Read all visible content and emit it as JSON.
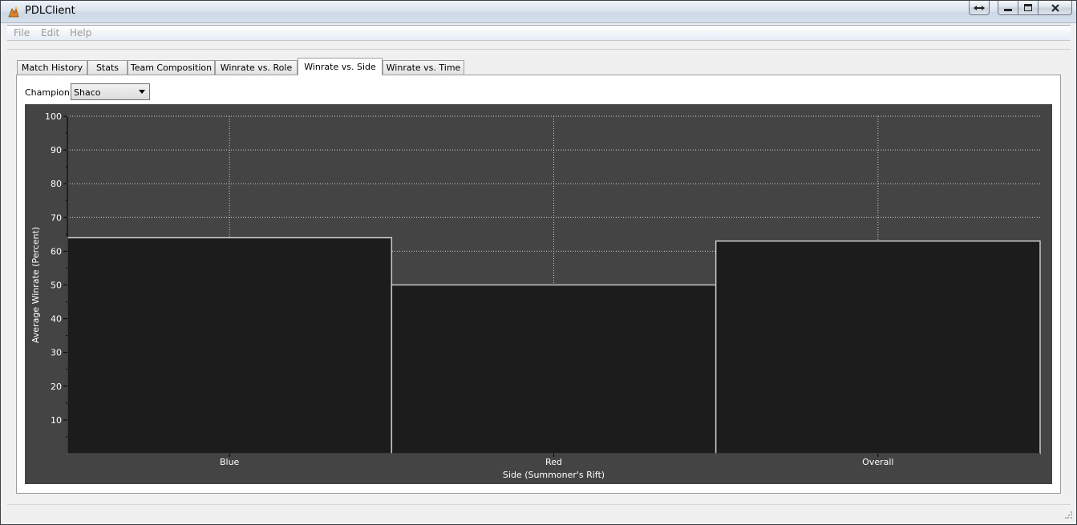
{
  "window": {
    "title": "PDLClient",
    "icon": "app-logo-icon"
  },
  "menu": [
    "File",
    "Edit",
    "Help"
  ],
  "tabs": [
    {
      "label": "Match History",
      "active": false
    },
    {
      "label": "Stats",
      "active": false
    },
    {
      "label": "Team Composition",
      "active": false
    },
    {
      "label": "Winrate vs. Role",
      "active": false
    },
    {
      "label": "Winrate vs. Side",
      "active": true
    },
    {
      "label": "Winrate vs. Time",
      "active": false
    }
  ],
  "filter": {
    "label": "Champion:",
    "value": "Shaco"
  },
  "colors": {
    "plot_background": "#444444",
    "bar_fill": "#1c1c1c",
    "bar_outline": "#c8c8c8",
    "grid": "#d0d0d0",
    "text": "#ffffff"
  },
  "chart_data": {
    "type": "bar",
    "categories": [
      "Blue",
      "Red",
      "Overall"
    ],
    "values": [
      64,
      50,
      63
    ],
    "xlabel": "Side (Summoner's Rift)",
    "ylabel": "Average Winrate (Percent)",
    "ylim": [
      0,
      100
    ],
    "yticks": [
      10,
      20,
      30,
      40,
      50,
      60,
      70,
      80,
      90,
      100
    ],
    "grid": true
  }
}
